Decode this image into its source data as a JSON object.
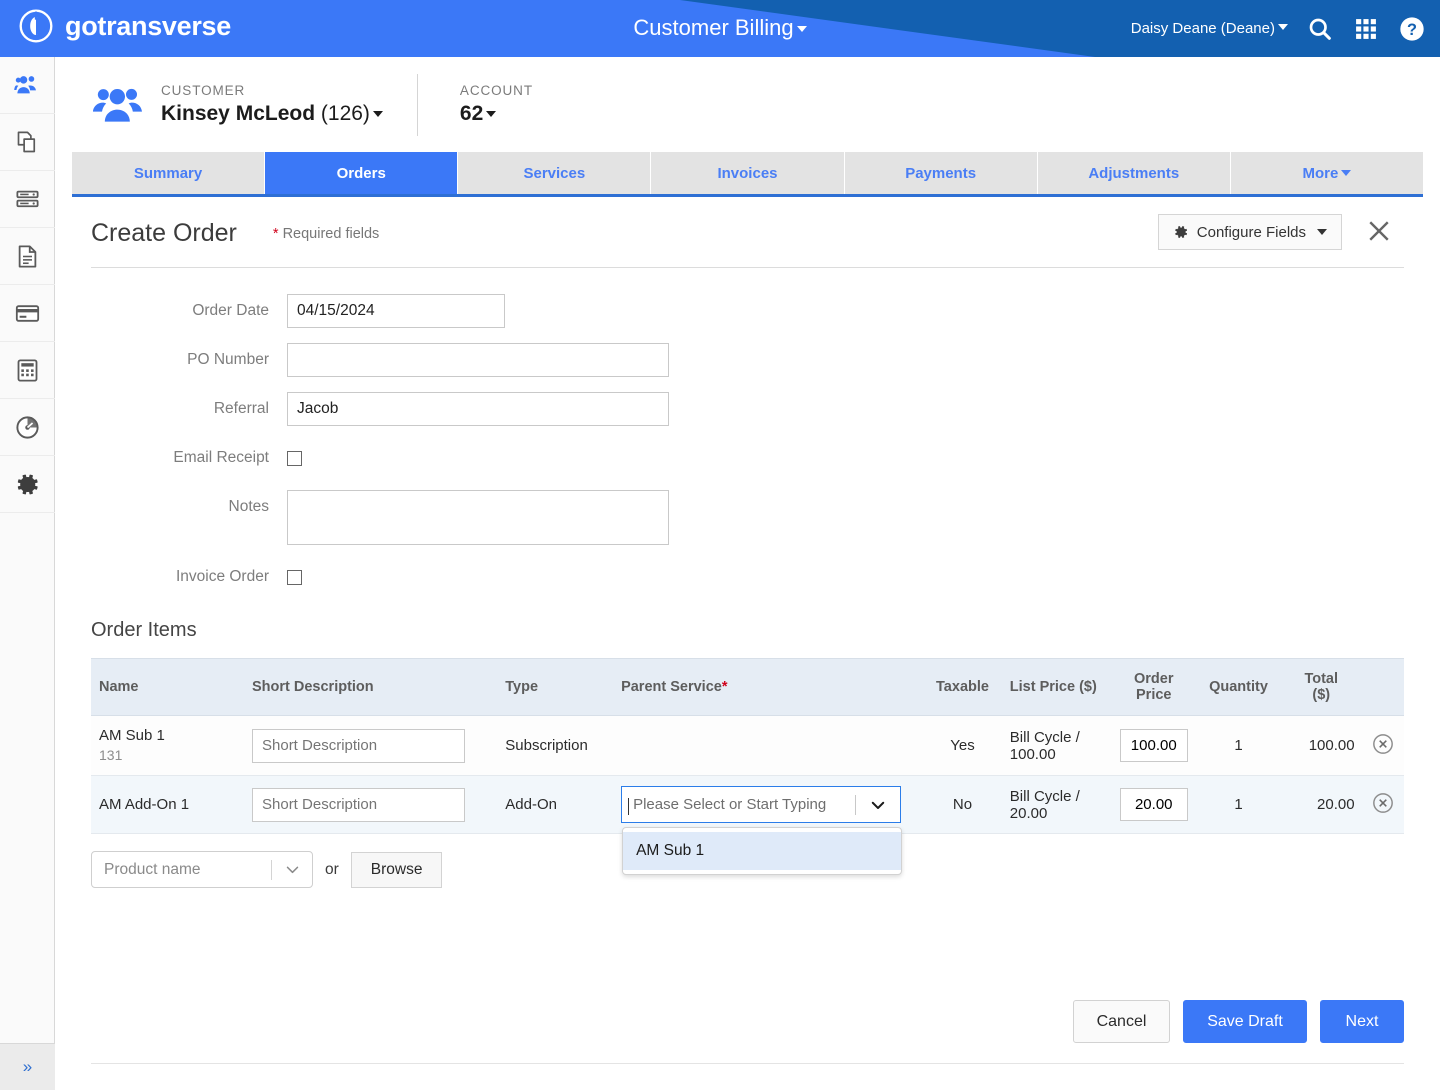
{
  "topbar": {
    "brand": "gotransverse",
    "brand_logo_icon": "circle-swirl-logo-icon",
    "app_title": "Customer Billing",
    "user_menu": "Daisy Deane (Deane)",
    "search_icon": "search-icon",
    "apps_icon": "apps-grid-icon",
    "help_icon": "help-circle-icon",
    "bg_dark": "#1360b0",
    "bg_light": "#3b78f7"
  },
  "sidebar": {
    "items": [
      {
        "icon": "customers-people-icon",
        "active": true
      },
      {
        "icon": "copy-pages-icon",
        "active": false
      },
      {
        "icon": "server-rates-icon",
        "active": false
      },
      {
        "icon": "document-invoice-icon",
        "active": false
      },
      {
        "icon": "credit-card-icon",
        "active": false
      },
      {
        "icon": "calculator-icon",
        "active": false
      },
      {
        "icon": "gauge-dashboard-icon",
        "active": false
      },
      {
        "icon": "settings-gear-icon",
        "active": false
      }
    ],
    "expand_label": "»",
    "expand_icon": "double-chevron-right-icon"
  },
  "context_bar": {
    "customer_icon": "customers-people-icon",
    "customer_label": "Customer",
    "customer_name": "Kinsey McLeod",
    "customer_id": "(126)",
    "account_label": "Account",
    "account_value": "62"
  },
  "tabs": [
    {
      "label": "Summary",
      "active": false
    },
    {
      "label": "Orders",
      "active": true
    },
    {
      "label": "Services",
      "active": false
    },
    {
      "label": "Invoices",
      "active": false
    },
    {
      "label": "Payments",
      "active": false
    },
    {
      "label": "Adjustments",
      "active": false
    },
    {
      "label": "More",
      "active": false,
      "has_caret": true
    }
  ],
  "panel": {
    "title": "Create Order",
    "required_star": "*",
    "required_note": "Required fields",
    "configure_fields_label": "Configure Fields",
    "gear_icon": "gear-icon",
    "close_icon": "close-x-icon"
  },
  "form": {
    "order_date": {
      "label": "Order Date",
      "value": "04/15/2024"
    },
    "po_number": {
      "label": "PO Number",
      "value": ""
    },
    "referral": {
      "label": "Referral",
      "value": "Jacob"
    },
    "email_receipt": {
      "label": "Email Receipt",
      "checked": false
    },
    "notes": {
      "label": "Notes",
      "value": ""
    },
    "invoice_order": {
      "label": "Invoice Order",
      "checked": false
    }
  },
  "order_items": {
    "section_title": "Order Items",
    "columns": {
      "name": "Name",
      "short_description": "Short Description",
      "type": "Type",
      "parent_service": "Parent Service",
      "parent_service_star": "*",
      "taxable": "Taxable",
      "list_price": "List Price ($)",
      "order_price_l1": "Order",
      "order_price_l2": "Price",
      "quantity": "Quantity",
      "total_l1": "Total",
      "total_l2": "($)"
    },
    "rows": [
      {
        "name": "AM Sub 1",
        "id": "131",
        "short_description": "",
        "short_description_placeholder": "Short Description",
        "type": "Subscription",
        "parent_service": "",
        "taxable": "Yes",
        "list_price": "Bill Cycle / 100.00",
        "order_price": "100.00",
        "quantity": "1",
        "total": "100.00",
        "delete_icon": "delete-circle-x-icon"
      },
      {
        "name": "AM Add-On 1",
        "id": "",
        "short_description": "",
        "short_description_placeholder": "Short Description",
        "type": "Add-On",
        "parent_service_placeholder": "Please Select or Start Typing",
        "taxable": "No",
        "list_price": "Bill Cycle / 20.00",
        "order_price": "20.00",
        "quantity": "1",
        "total": "20.00",
        "delete_icon": "delete-circle-x-icon"
      }
    ],
    "dropdown": {
      "open": true,
      "chevron_icon": "chevron-down-icon",
      "options": [
        "AM Sub 1"
      ]
    }
  },
  "product_picker": {
    "select_placeholder": "Product name",
    "chevron_icon": "chevron-down-icon",
    "or_label": "or",
    "browse_label": "Browse"
  },
  "actions": {
    "cancel": "Cancel",
    "save_draft": "Save Draft",
    "next": "Next"
  }
}
